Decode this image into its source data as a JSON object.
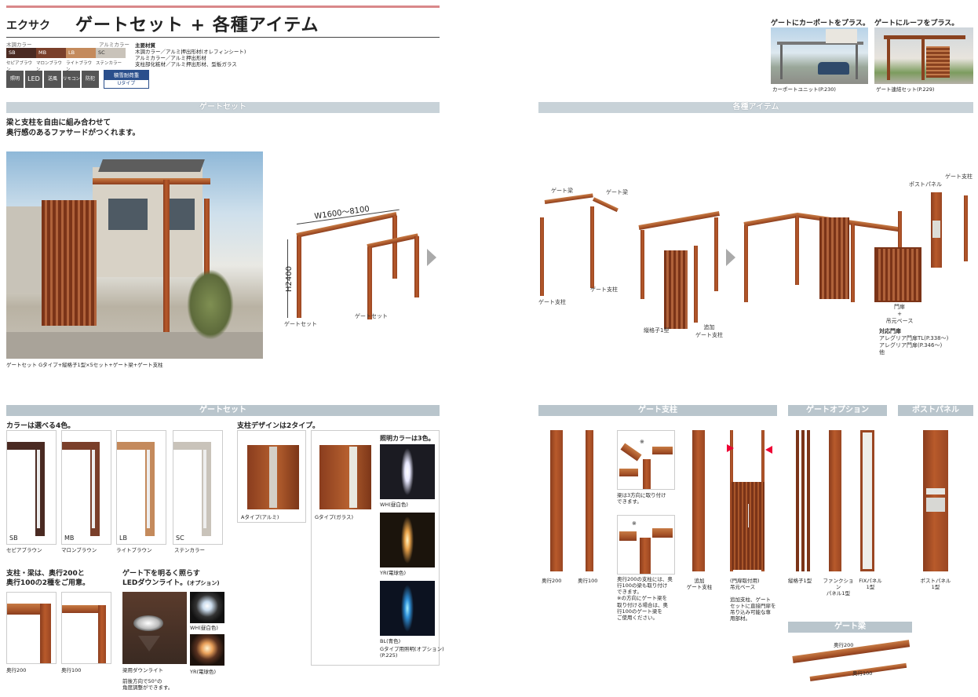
{
  "header": {
    "brand": "エクサク",
    "title": "ゲートセット + 各種アイテム"
  },
  "colors_header": {
    "wood_label": "木調カラー",
    "alu_label": "アルミカラー",
    "swatches": [
      {
        "code": "SB",
        "name": "セピアブラウン",
        "color": "#4a2a22"
      },
      {
        "code": "MB",
        "name": "マロンブラウン",
        "color": "#7a3f2a"
      },
      {
        "code": "LB",
        "name": "ライトブラウン",
        "color": "#c48a5c"
      },
      {
        "code": "SC",
        "name": "ステンカラー",
        "color": "#c9c3ba"
      }
    ]
  },
  "materials": {
    "title": "主要材質",
    "lines": [
      "木調カラー／アルミ押出形材(オレフィンシート)",
      "アルミカラー／アルミ押出形材",
      "支柱部化粧材／アルミ押出形材、型板ガラス"
    ]
  },
  "icons": {
    "items": [
      "照明",
      "LED",
      "送風",
      "リモコン",
      "防犯"
    ],
    "badge_top": "積雪耐荷重",
    "badge_bottom": "Uタイプ"
  },
  "top_right": {
    "caption1": "ゲートにカーポートをプラス。",
    "caption2": "ゲートにルーフをプラス。",
    "photo1": "カーポートユニット(P.230)",
    "photo2": "ゲート連結セット(P.229)"
  },
  "bands": {
    "gate_set": "ゲートセット",
    "items": "各種アイテム",
    "gate_set2": "ゲートセット",
    "post": "ゲート支柱",
    "option": "ゲートオプション",
    "post_panel": "ポストパネル",
    "beam": "ゲート梁"
  },
  "intro": {
    "line1": "梁と支柱を自由に組み合わせて",
    "line2": "奥行感のあるファサードがつくれます。"
  },
  "photo_caption": "ゲートセット Gタイプ+縦格子1型×5セット+ゲート梁+ゲート支柱",
  "diagram1": {
    "width": "W1600～8100",
    "height": "H2400",
    "label1": "ゲートセット",
    "label2": "ゲートセット"
  },
  "diagram2": {
    "beam1": "ゲート梁",
    "beam2": "ゲート梁",
    "post1": "ゲート支柱",
    "post2": "ゲート支柱",
    "lattice": "縦格子1型",
    "extra_post1": "追加",
    "extra_post2": "ゲート支柱",
    "post_panel": "ポストパネル",
    "gate_post": "ゲート支柱",
    "door": "門扉",
    "plus": "+",
    "base": "吊元ベース",
    "compat_title": "対応門扉",
    "compat1": "アレグリア門扉TL(P.338～)",
    "compat2": "アレグリア門扉(P.346～)",
    "compat3": "他"
  },
  "color_section": {
    "title": "カラーは選べる4色。"
  },
  "depth": {
    "title1": "支柱・梁は、奥行200と",
    "title2": "奥行100の2種をご用意。",
    "label1": "奥行200",
    "label2": "奥行100"
  },
  "led": {
    "title1": "ゲート下を明るく照らす",
    "title2": "LEDダウンライト。",
    "title2b": "(オプション)",
    "wh": "WH(昼白色)",
    "yr": "YR(電球色)",
    "cap": "梁用ダウンライト",
    "note1": "前後方向で50°の",
    "note2": "角度調整ができます。"
  },
  "design": {
    "title": "支柱デザインは2タイプ。",
    "a": "Aタイプ(アルミ)",
    "g": "Gタイプ(ガラス)",
    "light_title": "照明カラーは3色。",
    "wh": "WH(昼白色)",
    "yr": "YR(電球色)",
    "bl": "BL(青色)",
    "note1": "Gタイプ用照明(オプション)",
    "note2": "(P.225)"
  },
  "post_section": {
    "d200": "奥行200",
    "d100": "奥行100",
    "note1a": "梁は3方向に取り付け",
    "note1b": "できます。",
    "note2a": "奥行200の支柱には、奥",
    "note2b": "行100の梁も取り付け",
    "note2c": "できます。",
    "note2d": "※の方向にゲート梁を",
    "note2e": "取り付ける場合は、奥",
    "note2f": "行100のゲート梁を",
    "note2g": "ご使用ください。",
    "extra1": "追加",
    "extra2": "ゲート支柱",
    "base1": "(門扉取付用)",
    "base2": "吊元ベース",
    "base_note1": "追加支柱、ゲート",
    "base_note2": "セットに直接門扉を",
    "base_note3": "吊り込み可能な専",
    "base_note4": "用部材。",
    "mark": "※"
  },
  "option_section": {
    "l1": "縦格子1型",
    "l2a": "ファンクション",
    "l2b": "パネル1型",
    "l3a": "FIXパネル",
    "l3b": "1型"
  },
  "panel_section": {
    "l1": "ポストパネル",
    "l2": "1型"
  },
  "beam_section": {
    "d200": "奥行200",
    "d100": "奥行100"
  }
}
